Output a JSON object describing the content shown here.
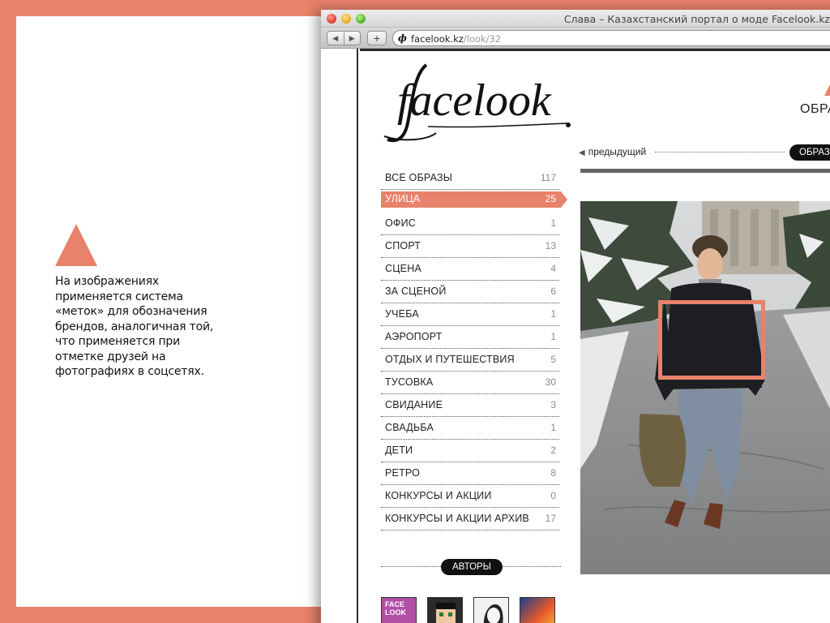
{
  "slide": {
    "caption": "На изображениях применяется система «меток» для обозначения брендов, аналогичная той, что применяется при отметке друзей на фотографиях в соцсетях.",
    "accent_color": "#e8826a"
  },
  "browser": {
    "window_title": "Слава – Казахстанский портал о моде Facelook.kz",
    "url_domain": "facelook.kz",
    "url_path": "/look/32",
    "back_icon": "◀",
    "forward_icon": "▶",
    "add_icon": "+"
  },
  "site": {
    "logo": "facelook",
    "nav_label": "ОБРАЗ",
    "prev_label": "предыдущий",
    "looks_pill": "ОБРАЗЫ",
    "authors_label": "АВТОРЫ",
    "author_thumb_1": "FACE LOOK"
  },
  "categories": [
    {
      "label": "ВСЕ ОБРАЗЫ",
      "count": "117"
    },
    {
      "label": "УЛИЦА",
      "count": "25",
      "active": true
    },
    {
      "label": "ОФИС",
      "count": "1"
    },
    {
      "label": "СПОРТ",
      "count": "13"
    },
    {
      "label": "СЦЕНА",
      "count": "4"
    },
    {
      "label": "ЗА СЦЕНОЙ",
      "count": "6"
    },
    {
      "label": "УЧЕБА",
      "count": "1"
    },
    {
      "label": "АЭРОПОРТ",
      "count": "1"
    },
    {
      "label": "ОТДЫХ И ПУТЕШЕСТВИЯ",
      "count": "5"
    },
    {
      "label": "ТУСОВКА",
      "count": "30"
    },
    {
      "label": "СВИДАНИЕ",
      "count": "3"
    },
    {
      "label": "СВАДЬБА",
      "count": "1"
    },
    {
      "label": "ДЕТИ",
      "count": "2"
    },
    {
      "label": "РЕТРО",
      "count": "8"
    },
    {
      "label": "КОНКУРСЫ И АКЦИИ",
      "count": "0"
    },
    {
      "label": "КОНКУРСЫ И АКЦИИ АРХИВ",
      "count": "17"
    }
  ]
}
